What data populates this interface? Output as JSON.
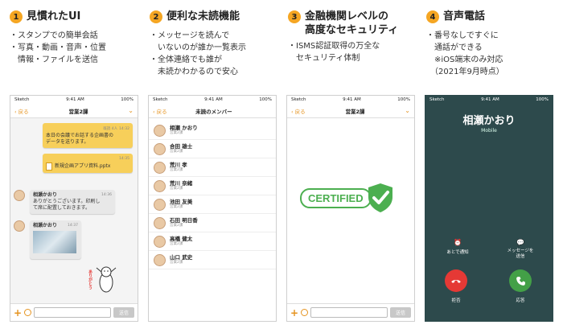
{
  "features": [
    {
      "num": "1",
      "title": "見慣れたUI",
      "bullets": "・スタンプでの簡単会話\n・写真・動画・音声・位置\n　情報・ファイルを送信"
    },
    {
      "num": "2",
      "title": "便利な未読機能",
      "bullets": "・メッセージを読んで\n　いないのが誰か一覧表示\n・全体連絡でも誰が\n　未読かわかるので安心"
    },
    {
      "num": "3",
      "title": "金融機関レベルの\n高度なセキュリティ",
      "bullets": "・ISMS認証取得の万全な\n　セキュリティ体制"
    },
    {
      "num": "4",
      "title": "音声電話",
      "bullets": "・番号なしですぐに\n　通話ができる\n　※iOS端末のみ対応\n　（2021年9月時点）"
    }
  ],
  "status": {
    "carrier": "Sketch",
    "time": "9:41 AM",
    "battery": "100%"
  },
  "phone1": {
    "back": "戻る",
    "title": "営業2課",
    "msg1": {
      "read": "既読 4人",
      "time": "14:32",
      "text": "本日の会議でお話する企画書の\nデータを送ります。"
    },
    "msg2": {
      "time": "14:35",
      "file": "新規企画アプリ資料.pptx"
    },
    "msg3": {
      "name": "相瀬かおり",
      "time": "14:36",
      "text": "ありがとうございます。印刷し\nて席に配置しておきます。"
    },
    "msg4": {
      "name": "相瀬かおり",
      "time": "14:37"
    },
    "stamp": "ありがとう",
    "send": "送信"
  },
  "phone2": {
    "back": "戻る",
    "title": "未読のメンバー",
    "members": [
      {
        "name": "相瀬 かおり",
        "dept": "営業2課"
      },
      {
        "name": "合田 雄士",
        "dept": "営業2課"
      },
      {
        "name": "荒川 孝",
        "dept": "営業2課"
      },
      {
        "name": "荒川 奈緒",
        "dept": "営業2課"
      },
      {
        "name": "池田 友美",
        "dept": "営業2課"
      },
      {
        "name": "石田 明日香",
        "dept": "営業2課"
      },
      {
        "name": "高橋 健太",
        "dept": "営業2課"
      },
      {
        "name": "山口 武史",
        "dept": "営業2課"
      }
    ]
  },
  "phone3": {
    "back": "戻る",
    "title": "営業2課",
    "badge": "CERTIFIED",
    "send": "送信"
  },
  "phone4": {
    "caller": "相瀬かおり",
    "type": "Mobile",
    "remind": "あとで通知",
    "message": "メッセージを\n送信",
    "decline": "拒否",
    "accept": "応答"
  },
  "colors": {
    "accent": "#f5a623",
    "badge_green": "#4caf50",
    "call_bg": "#2d4a4c",
    "decline": "#e53935",
    "accept": "#43a047"
  }
}
